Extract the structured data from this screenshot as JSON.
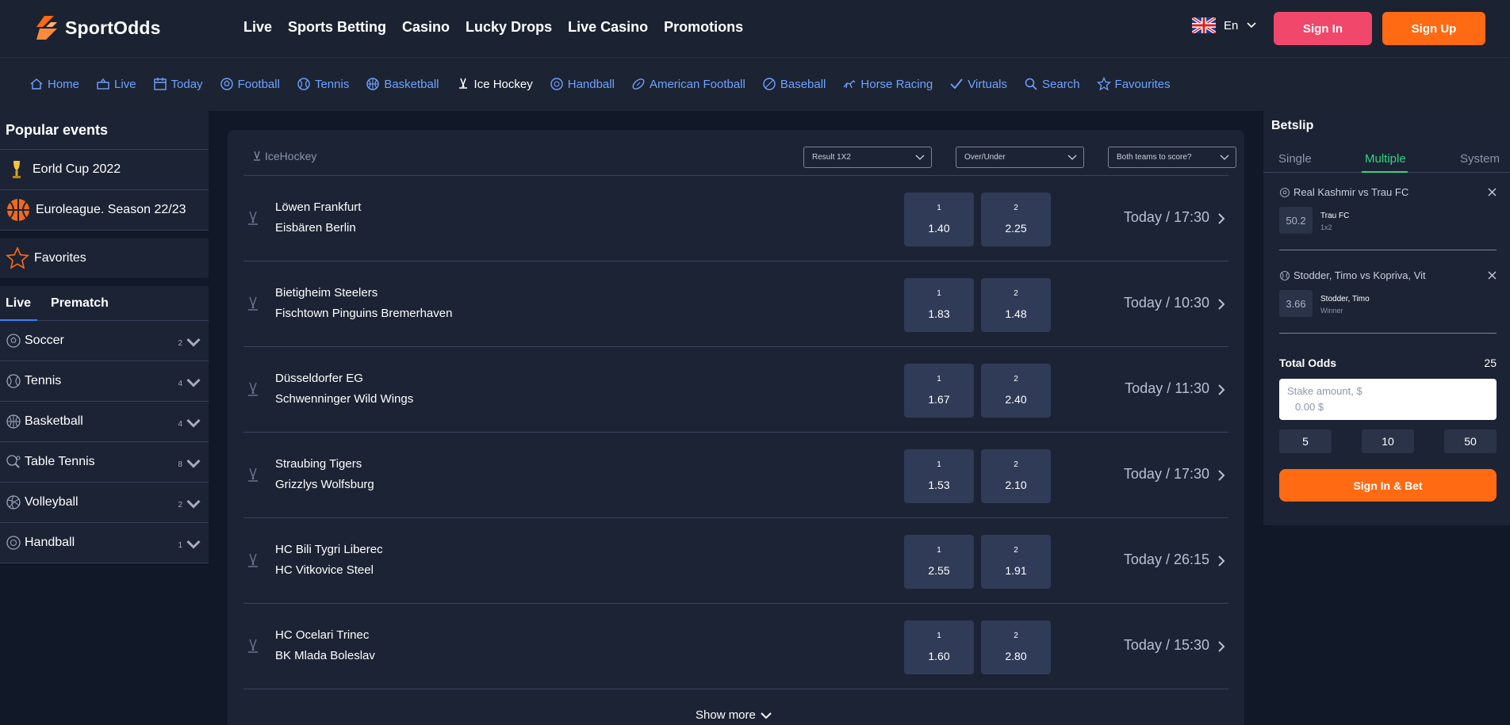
{
  "brand": {
    "name": "SportOdds",
    "accent": "#ff6a13"
  },
  "topnav": [
    "Live",
    "Sports Betting",
    "Casino",
    "Lucky Drops",
    "Live Casino",
    "Promotions"
  ],
  "lang": {
    "label": "En"
  },
  "auth": {
    "signin": "Sign In",
    "signup": "Sign Up"
  },
  "sportsnav": [
    {
      "label": "Home",
      "icon": "home-icon"
    },
    {
      "label": "Live",
      "icon": "live-icon"
    },
    {
      "label": "Today",
      "icon": "calendar-icon"
    },
    {
      "label": "Football",
      "icon": "football-icon"
    },
    {
      "label": "Tennis",
      "icon": "tennis-icon"
    },
    {
      "label": "Basketball",
      "icon": "basketball-icon"
    },
    {
      "label": "Ice Hockey",
      "icon": "hockey-icon",
      "active": true
    },
    {
      "label": "Handball",
      "icon": "handball-icon"
    },
    {
      "label": "American Football",
      "icon": "american-football-icon"
    },
    {
      "label": "Baseball",
      "icon": "baseball-icon"
    },
    {
      "label": "Horse Racing",
      "icon": "horse-icon"
    },
    {
      "label": "Virtuals",
      "icon": "check-icon"
    },
    {
      "label": "Search",
      "icon": "search-icon"
    },
    {
      "label": "Favourites",
      "icon": "star-icon"
    }
  ],
  "sidebar": {
    "popular_title": "Popular events",
    "events": [
      "Eorld Cup 2022",
      "Euroleague. Season 22/23"
    ],
    "favorites": "Favorites",
    "tabs": [
      "Live",
      "Prematch"
    ],
    "sports": [
      {
        "label": "Soccer",
        "count": "2"
      },
      {
        "label": "Tennis",
        "count": "4"
      },
      {
        "label": "Basketball",
        "count": "4"
      },
      {
        "label": "Table Tennis",
        "count": "8"
      },
      {
        "label": "Volleyball",
        "count": "2"
      },
      {
        "label": "Handball",
        "count": "1"
      }
    ]
  },
  "main": {
    "title": "IceHockey",
    "filters": [
      "Result 1X2",
      "Over/Under",
      "Both teams to score?"
    ],
    "matches": [
      {
        "home": "Löwen Frankfurt",
        "away": "Eisbären Berlin",
        "o1": "1.40",
        "o2": "2.25",
        "time": "Today / 17:30"
      },
      {
        "home": "Bietigheim Steelers",
        "away": "Fischtown Pinguins Bremerhaven",
        "o1": "1.83",
        "o2": "1.48",
        "time": "Today / 10:30"
      },
      {
        "home": "Düsseldorfer EG",
        "away": "Schwenninger Wild Wings",
        "o1": "1.67",
        "o2": "2.40",
        "time": "Today / 11:30"
      },
      {
        "home": "Straubing Tigers",
        "away": "Grizzlys Wolfsburg",
        "o1": "1.53",
        "o2": "2.10",
        "time": "Today / 17:30"
      },
      {
        "home": "HC Bili Tygri Liberec",
        "away": "HC Vitkovice Steel",
        "o1": "2.55",
        "o2": "1.91",
        "time": "Today / 26:15"
      },
      {
        "home": "HC Ocelari Trinec",
        "away": "BK Mlada Boleslav",
        "o1": "1.60",
        "o2": "2.80",
        "time": "Today / 15:30"
      }
    ],
    "odd_labels": [
      "1",
      "2"
    ],
    "show_more": "Show more"
  },
  "betslip": {
    "title": "Betslip",
    "tabs": [
      "Single",
      "Multiple",
      "System"
    ],
    "bets": [
      {
        "event": "Real Kashmir vs Trau FC",
        "odd": "50.2",
        "selection": "Trau FC",
        "market": "1x2"
      },
      {
        "event": "Stodder, Timo vs Kopriva, Vit",
        "odd": "3.66",
        "selection": "Stodder, Timo",
        "market": "Winner"
      }
    ],
    "total_label": "Total Odds",
    "total_value": "25",
    "stake_placeholder": "Stake amount, $",
    "stake_value": "0.00 $",
    "quick": [
      "5",
      "10",
      "50"
    ],
    "cta": "Sign In & Bet"
  }
}
